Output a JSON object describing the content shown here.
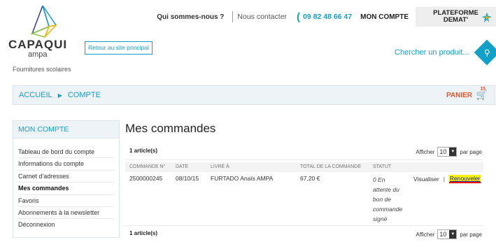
{
  "header": {
    "brand_name": "CAPAQUI",
    "brand_sub": "ampa",
    "tagline": "Fournitures scolaires",
    "nav_who": "Qui sommes-nous ?",
    "nav_contact": "Nous contacter",
    "nav_phone": "09 82 48 66 47",
    "nav_account": "MON COMPTE",
    "platform_line1": "PLATEFORME",
    "platform_line2": "DEMAT'",
    "back_link": "Retour au site principal",
    "search_label": "Chercher un produit..."
  },
  "breadcrumb": {
    "home": "ACCUEIL",
    "current": "COMPTE",
    "cart_label": "PANIER",
    "cart_count": "15"
  },
  "sidebar": {
    "title": "MON COMPTE",
    "items": [
      {
        "label": "Tableau de bord du compte"
      },
      {
        "label": "Informations du compte"
      },
      {
        "label": "Carnet d'adresses"
      },
      {
        "label": "Mes commandes"
      },
      {
        "label": "Favoris"
      },
      {
        "label": "Abonnements à la newsletter"
      },
      {
        "label": "Déconnexion"
      }
    ]
  },
  "main": {
    "title": "Mes commandes",
    "count_text": "1 article(s)",
    "show_label": "Afficher",
    "per_page_value": "10",
    "per_page_label": "par page",
    "columns": [
      "COMMANDE N°",
      "DATE",
      "LIVRÉ À",
      "TOTAL DE LA COMMANDE",
      "STATUT"
    ],
    "orders": [
      {
        "number": "2500000245",
        "date": "08/10/15",
        "ship_to": "FURTADO Anaïs AMPA",
        "total": "67,20 €",
        "status_lines": [
          "0 En",
          "attente du",
          "bon de",
          "commande",
          "signé"
        ],
        "view_label": "Visualiser",
        "reorder_label": "Renouveler"
      }
    ]
  },
  "colors": {
    "accent": "#12a0c9",
    "cart": "#e2582b",
    "highlight": "#fff400"
  }
}
